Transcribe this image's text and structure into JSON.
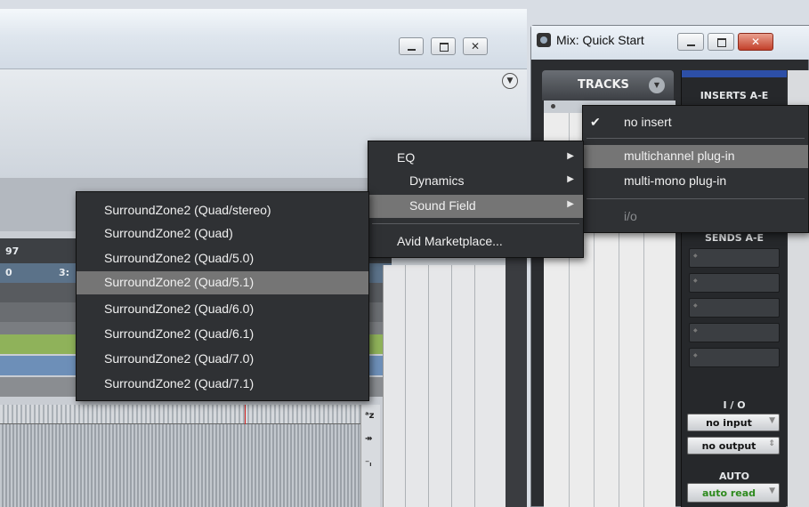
{
  "edit_window": {
    "ruler_values": [
      "97",
      "0",
      "3:"
    ],
    "side_icons": [
      "ᵃz",
      "↠",
      "⁻ₗ"
    ]
  },
  "mix_window": {
    "title": "Mix: Quick Start",
    "tracks_label": "TRACKS",
    "inserts_label": "INSERTS A-E",
    "sends_label": "SENDS A-E",
    "io_label": "I / O",
    "input_button": "no input",
    "output_button": "no output",
    "auto_label": "AUTO",
    "auto_button": "auto read"
  },
  "insert_menu": {
    "items": [
      {
        "label": "no insert",
        "checked": true
      },
      {
        "label": "multichannel plug-in",
        "highlighted": true
      },
      {
        "label": "multi-mono plug-in"
      },
      {
        "label": "i/o",
        "disabled": true
      }
    ]
  },
  "category_menu": {
    "items": [
      {
        "label": "EQ",
        "submenu": true
      },
      {
        "label": "Dynamics",
        "submenu": true
      },
      {
        "label": "Sound Field",
        "submenu": true,
        "highlighted": true
      },
      {
        "label": "Avid Marketplace..."
      }
    ]
  },
  "plugin_menu": {
    "items": [
      "SurroundZone2 (Quad/stereo)",
      "SurroundZone2 (Quad)",
      "SurroundZone2 (Quad/5.0)",
      "SurroundZone2 (Quad/5.1)",
      "SurroundZone2 (Quad/6.0)",
      "SurroundZone2 (Quad/6.1)",
      "SurroundZone2 (Quad/7.0)",
      "SurroundZone2 (Quad/7.1)"
    ],
    "highlighted_index": 3
  },
  "colors": {
    "menu_bg": "#2f3134",
    "menu_highlight": "#757575",
    "track_green": "#8fb25a",
    "track_blue": "#6d8fb8",
    "auto_read_text": "#2e8a1e",
    "close_red": "#c2402a"
  }
}
